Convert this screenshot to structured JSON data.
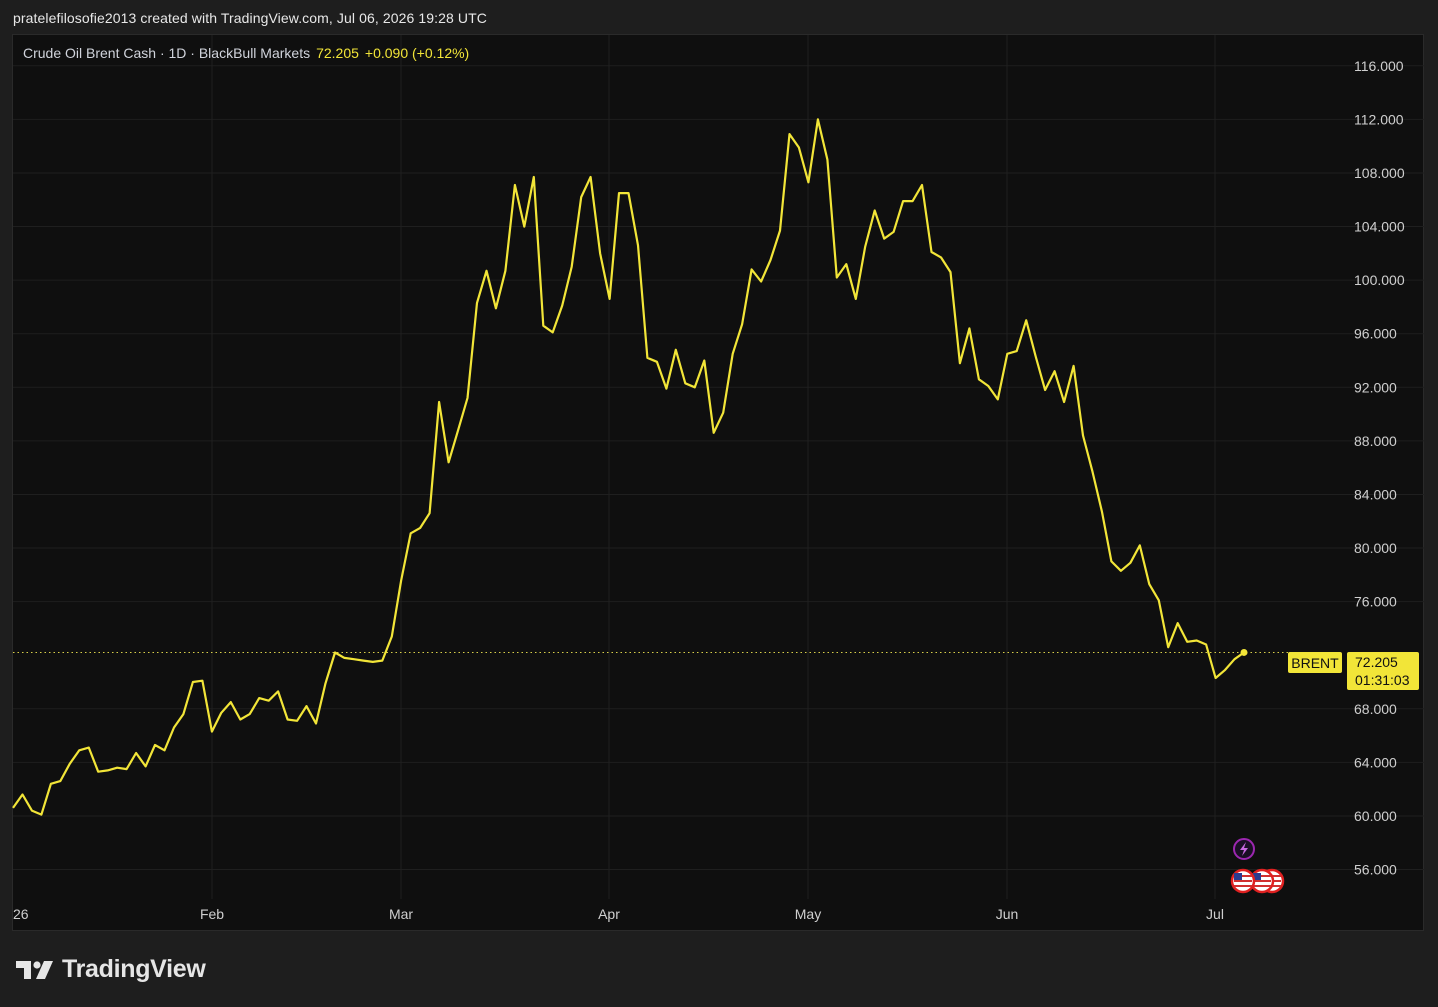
{
  "header": {
    "title": "pratelefilosofie2013 created with TradingView.com, Jul 06, 2026 19:28 UTC"
  },
  "legend": {
    "symbol": "Crude Oil Brent Cash · 1D · BlackBull Markets",
    "price": "72.205",
    "change": "+0.090 (+0.12%)"
  },
  "price_label": {
    "symbol": "BRENT",
    "price": "72.205",
    "countdown": "01:31:03"
  },
  "brand": {
    "logo_text": "TradingView"
  },
  "colors": {
    "line": "#f2e538",
    "background": "#0f0f0f",
    "grid": "#1f1f1f",
    "axis_text": "#cfcfcf"
  },
  "chart_data": {
    "type": "line",
    "series": [
      {
        "name": "BRENT",
        "values": [
          60.6,
          61.6,
          60.4,
          60.1,
          62.4,
          62.6,
          63.9,
          64.9,
          65.1,
          63.3,
          63.4,
          63.6,
          63.5,
          64.7,
          63.7,
          65.3,
          64.9,
          66.6,
          67.6,
          70.0,
          70.1,
          66.3,
          67.7,
          68.5,
          67.2,
          67.6,
          68.8,
          68.6,
          69.3,
          67.2,
          67.1,
          68.2,
          66.9,
          69.9,
          72.2,
          71.8,
          71.7,
          71.6,
          71.5,
          71.6,
          73.4,
          77.6,
          81.1,
          81.5,
          82.6,
          90.9,
          86.4,
          88.8,
          91.2,
          98.3,
          100.7,
          97.9,
          100.7,
          107.1,
          104.0,
          107.7,
          96.6,
          96.1,
          98.1,
          101.0,
          106.2,
          107.7,
          102.0,
          98.6,
          106.5,
          106.5,
          102.6,
          94.2,
          93.9,
          91.9,
          94.8,
          92.3,
          92.0,
          94.0,
          88.6,
          90.1,
          94.5,
          96.7,
          100.8,
          99.9,
          101.5,
          103.7,
          110.9,
          109.9,
          107.3,
          112.0,
          109.0,
          100.2,
          101.2,
          98.6,
          102.5,
          105.2,
          103.1,
          103.6,
          105.9,
          105.9,
          107.1,
          102.1,
          101.7,
          100.6,
          93.8,
          96.4,
          92.6,
          92.1,
          91.1,
          94.5,
          94.7,
          97.0,
          94.3,
          91.8,
          93.2,
          90.9,
          93.6,
          88.4,
          85.7,
          82.7,
          79.0,
          78.3,
          78.9,
          80.2,
          77.3,
          76.1,
          72.6,
          74.4,
          73.0,
          73.1,
          72.8,
          70.3,
          70.9,
          71.7,
          72.205
        ],
        "color": "#f2e538"
      }
    ],
    "x_tick_labels": [
      "26",
      "Feb",
      "Mar",
      "Apr",
      "May",
      "Jun",
      "Jul"
    ],
    "y_tick_values": [
      56,
      60,
      64,
      68,
      76,
      80,
      84,
      88,
      92,
      96,
      100,
      104,
      108,
      112,
      116
    ],
    "y_tick_labels": [
      "56.000",
      "60.000",
      "64.000",
      "68.000",
      "76.000",
      "80.000",
      "84.000",
      "88.000",
      "92.000",
      "96.000",
      "100.000",
      "104.000",
      "108.000",
      "112.000",
      "116.000"
    ],
    "ylim": [
      53.8,
      118.3
    ],
    "grid": true,
    "current_price_line": 72.205
  }
}
